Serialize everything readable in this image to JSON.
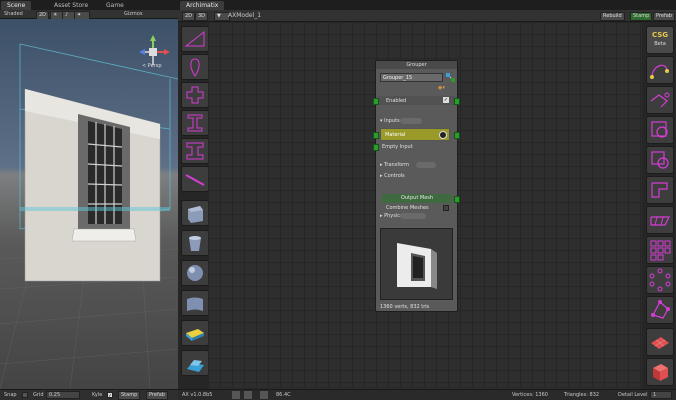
{
  "scene": {
    "tabs": [
      {
        "label": "Scene"
      },
      {
        "label": "Asset Store"
      },
      {
        "label": "Game"
      }
    ],
    "toolbar": {
      "shading": "Shaded",
      "mode_2d": "2D",
      "gizmos": "Gizmos"
    },
    "persp_label": "< Persp",
    "bottom": {
      "snap_label": "Snap",
      "grid_label": "Grid",
      "grid_value": "0.25",
      "kyle_label": "Kyle",
      "stamp_label": "Stamp",
      "prefab_label": "Prefab"
    }
  },
  "archimatix": {
    "tab_label": "Archimatix",
    "toolbar": {
      "btn_2d": "2D",
      "btn_3d": "3D",
      "model_name": "AXModel_1",
      "rebuild_label": "Rebuild",
      "stamp_label": "Stamp",
      "prefab_label": "Prefab"
    },
    "csg_logo": {
      "line1": "CSG",
      "line2": "Beta"
    },
    "status": {
      "version": "AX v1.0.8b5",
      "value_readout": "86.4C",
      "vertices": "Vertices: 1360",
      "triangles": "Triangles: 832",
      "detail_label": "Detail Level",
      "detail_value": "1"
    }
  },
  "node": {
    "header": "Grouper",
    "name_value": "Grouper_15",
    "enabled_label": "Enabled",
    "inputs_label": "Inputs",
    "material_label": "Material",
    "empty_label": "Empty Input",
    "transform_label": "Transform",
    "controls_label": "Controls",
    "output_label": "Output Mesh",
    "combine_label": "Combine Meshes",
    "physics_label": "Physics",
    "footer": "1360 verts, 832 tris"
  },
  "colors": {
    "accent_magenta": "#d63cd6",
    "accent_green": "#2c9a2c",
    "material_yellow": "#9a9a2a"
  }
}
